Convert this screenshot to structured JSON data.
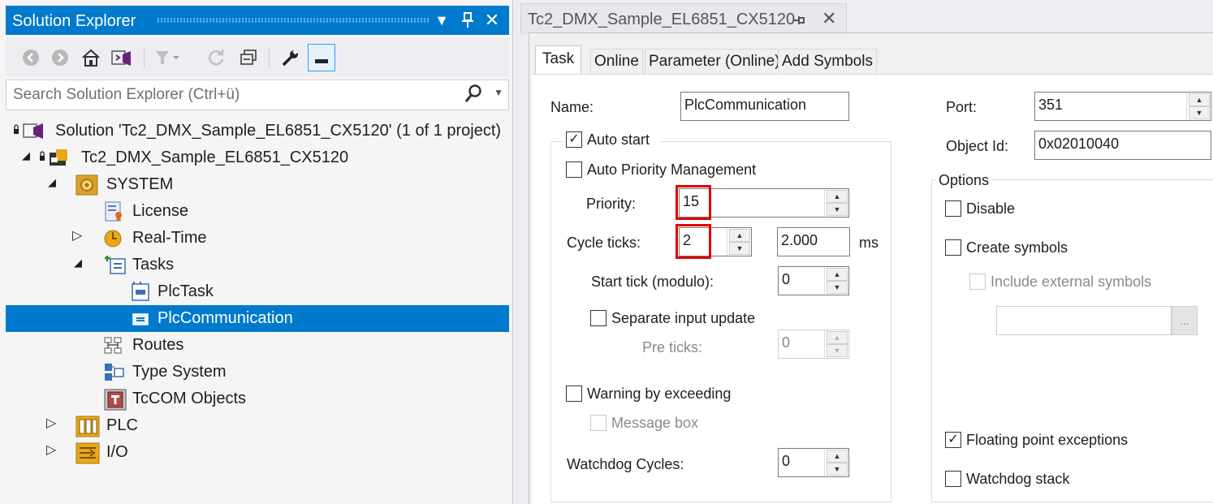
{
  "solution_explorer": {
    "title": "Solution Explorer",
    "search": {
      "placeholder": "Search Solution Explorer (Ctrl+ü)"
    },
    "toolbar": [
      "back-icon",
      "forward-icon",
      "home-icon",
      "vs-solution-icon",
      "filter-icon",
      "sync-icon",
      "collapse-all-icon",
      "properties-wrench-icon",
      "preview-icon"
    ],
    "tree": [
      {
        "label": "Solution 'Tc2_DMX_Sample_EL6851_CX5120' (1 of 1 project)"
      },
      {
        "label": "Tc2_DMX_Sample_EL6851_CX5120"
      },
      {
        "label": "SYSTEM"
      },
      {
        "label": "License"
      },
      {
        "label": "Real-Time"
      },
      {
        "label": "Tasks"
      },
      {
        "label": "PlcTask"
      },
      {
        "label": "PlcCommunication"
      },
      {
        "label": "Routes"
      },
      {
        "label": "Type System"
      },
      {
        "label": "TcCOM Objects"
      },
      {
        "label": "PLC"
      },
      {
        "label": "I/O"
      }
    ]
  },
  "document": {
    "tab_title": "Tc2_DMX_Sample_EL6851_CX5120",
    "tabs": [
      "Task",
      "Online",
      "Parameter (Online)",
      "Add Symbols"
    ],
    "task": {
      "name_label": "Name:",
      "name_value": "PlcCommunication",
      "auto_start": "Auto start",
      "auto_priority": "Auto Priority Management",
      "priority_label": "Priority:",
      "priority_value": "15",
      "cycle_label": "Cycle ticks:",
      "cycle_value": "2",
      "cycle_ms_value": "2.000",
      "ms_unit": "ms",
      "start_tick_label": "Start tick (modulo):",
      "start_tick_value": "0",
      "separate_input": "Separate input update",
      "pre_ticks_label": "Pre ticks:",
      "pre_ticks_value": "0",
      "warning_exceeding": "Warning by exceeding",
      "message_box": "Message box",
      "watchdog_label": "Watchdog Cycles:",
      "watchdog_value": "0",
      "port_label": "Port:",
      "port_value": "351",
      "object_id_label": "Object Id:",
      "object_id_value": "0x02010040",
      "options_label": "Options",
      "disable": "Disable",
      "create_symbols": "Create symbols",
      "include_external": "Include external symbols",
      "browse": "...",
      "floating_point": "Floating point exceptions",
      "watchdog_stack": "Watchdog stack",
      "check": "✓"
    }
  },
  "colors": {
    "accent": "#007acc",
    "highlight": "#e00000"
  }
}
